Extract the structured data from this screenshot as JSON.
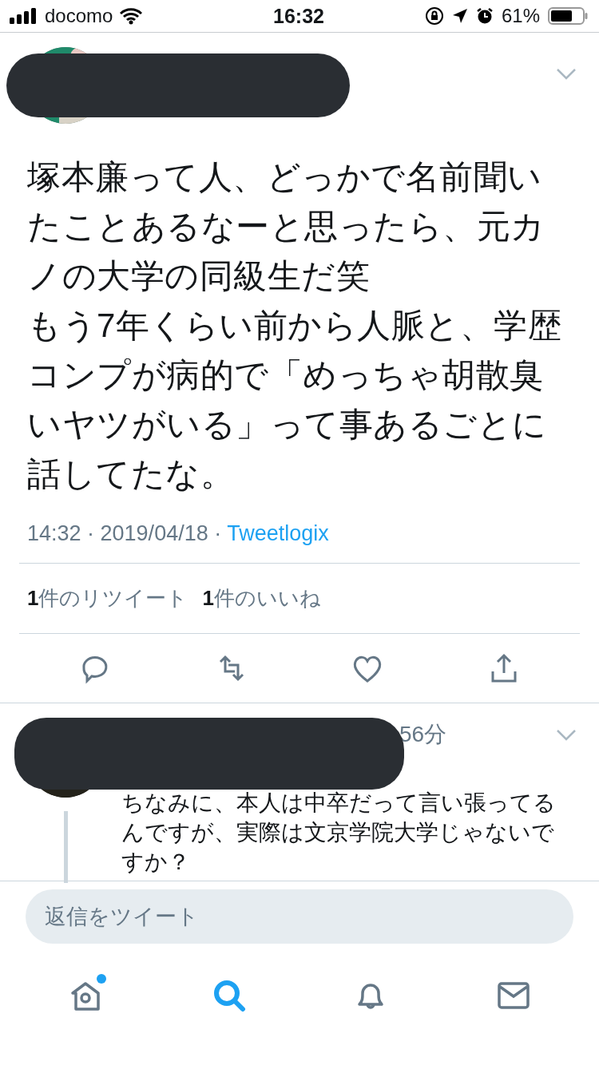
{
  "status_bar": {
    "carrier": "docomo",
    "time": "16:32",
    "battery": "61%"
  },
  "tweet": {
    "paragraphs": [
      "塚本廉って人、どっかで名前聞いたことあるなーと思ったら、元カノの大学の同級生だ笑",
      "もう7年くらい前から人脈と、学歴コンプが病的で「めっちゃ胡散臭いヤツがいる」って事あるごとに話してたな。"
    ],
    "timestamp": "14:32 · 2019/04/18 · ",
    "source": "Tweetlogix",
    "stats": [
      "**1**件のリツイート",
      "**1**件のいいね"
    ],
    "actions": [
      {
        "kind": "reply"
      },
      {
        "kind": "retweet"
      },
      {
        "kind": "like"
      },
      {
        "kind": "share"
      }
    ]
  },
  "reply": {
    "time": "56分",
    "text": "ちなみに、本人は中卒だって言い張ってるんですが、実際は文京学院大学じゃないですか？"
  },
  "composer": {
    "placeholder": "返信をツイート"
  },
  "tab_bar": [
    {
      "kind": "home",
      "selected": false,
      "notification_dot": true
    },
    {
      "kind": "search",
      "selected": true,
      "notification_dot": false
    },
    {
      "kind": "notifications",
      "selected": false,
      "notification_dot": false
    },
    {
      "kind": "messages",
      "selected": false,
      "notification_dot": false
    }
  ]
}
